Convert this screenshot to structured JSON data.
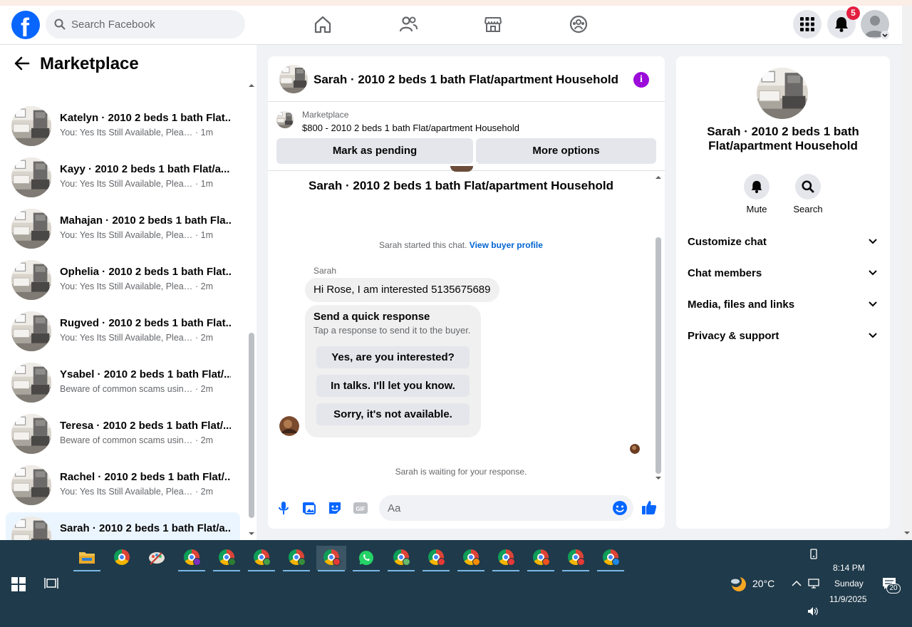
{
  "navbar": {
    "logo": "f",
    "search_placeholder": "Search Facebook",
    "notifications_count": "5"
  },
  "left": {
    "title": "Marketplace",
    "conversations": [
      {
        "name": "",
        "snippet": "You: Yes Its Still Available, Pleas...",
        "time": "· 1m"
      },
      {
        "name": "Katelyn · 2010 2 beds 1 bath Flat...",
        "snippet": "You: Yes Its Still Available, Please S...",
        "time": "· 1m"
      },
      {
        "name": "Kayy · 2010 2 beds 1 bath Flat/a...",
        "snippet": "You: Yes Its Still Available, Please S...",
        "time": "· 1m"
      },
      {
        "name": "Mahajan · 2010 2 beds 1 bath Fla...",
        "snippet": "You: Yes Its Still Available, Please S...",
        "time": "· 1m"
      },
      {
        "name": "Ophelia · 2010 2 beds 1 bath Flat...",
        "snippet": "You: Yes Its Still Available, Please S...",
        "time": "· 2m"
      },
      {
        "name": "Rugved · 2010 2 beds 1 bath Flat...",
        "snippet": "You: Yes Its Still Available, Please S...",
        "time": "· 2m"
      },
      {
        "name": "Ysabel · 2010 2 beds 1 bath Flat/...",
        "snippet": "Beware of common scams using p...",
        "time": "· 2m"
      },
      {
        "name": "Teresa · 2010 2 beds 1 bath Flat/...",
        "snippet": "Beware of common scams using p...",
        "time": "· 2m"
      },
      {
        "name": "Rachel · 2010 2 beds 1 bath Flat/...",
        "snippet": "You: Yes Its Still Available, Please S...",
        "time": "· 2m"
      },
      {
        "name": "Sarah · 2010 2 beds 1 bath Flat/a...",
        "snippet": "",
        "time": ""
      }
    ]
  },
  "chat": {
    "header_title": "Sarah · 2010 2 beds 1 bath Flat/apartment Household",
    "marketplace_label": "Marketplace",
    "listing": "$800 - 2010 2 beds 1 bath Flat/apartment Household",
    "mark_pending": "Mark as pending",
    "more_options": "More options",
    "conversation_title": "Sarah · 2010 2 beds 1 bath Flat/apartment Household",
    "started_text": "Sarah started this chat.",
    "view_buyer_profile": "View buyer profile",
    "sender": "Sarah",
    "message": "Hi Rose, I am interested 5135675689",
    "quick_title": "Send a quick response",
    "quick_subtitle": "Tap a response to send it to the buyer.",
    "quick_options": [
      "Yes, are you interested?",
      "In talks. I'll let you know.",
      "Sorry, it's not available."
    ],
    "waiting_text": "Sarah is waiting for your response.",
    "composer_placeholder": "Aa",
    "icons": [
      "microphone-icon",
      "photo-icon",
      "sticker-icon",
      "gif-icon",
      "emoji-icon",
      "thumbs-up-icon"
    ]
  },
  "right": {
    "title": "Sarah · 2010 2 beds 1 bath Flat/apartment Household",
    "mute": "Mute",
    "search": "Search",
    "sections": [
      "Customize chat",
      "Chat members",
      "Media, files and links",
      "Privacy & support"
    ]
  },
  "taskbar": {
    "weather": "20°C",
    "time": "8:14 PM",
    "day": "Sunday",
    "date": "11/9/2025",
    "notification_count": "20"
  },
  "colors": {
    "brand_blue": "#0866ff",
    "info_purple": "#9b0bd9",
    "taskbar": "#1f3a4a"
  }
}
